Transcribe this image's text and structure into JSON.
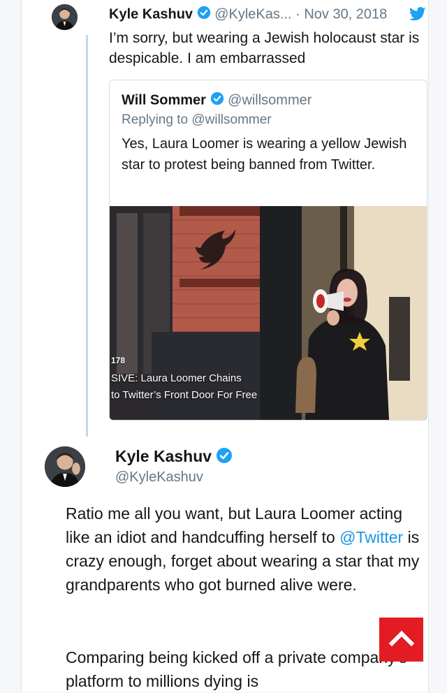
{
  "reply_tweet": {
    "name": "Kyle Kashuv",
    "handle": "@KyleKas...",
    "separator": "·",
    "date": "Nov 30, 2018",
    "text": "I’m sorry, but wearing a Jewish holocaust star is despicable. I am embarrassed"
  },
  "quoted_tweet": {
    "name": "Will Sommer",
    "handle": "@willsommer",
    "replying_to": "Replying to @willsommer",
    "text": "Yes, Laura Loomer is wearing a yellow Jewish star to protest being banned from Twitter.",
    "media": {
      "caption_number": "178",
      "caption_line1": "SIVE: Laura Loomer Chains",
      "caption_line2": "to Twitter’s Front Door For Free"
    }
  },
  "main_tweet": {
    "name": "Kyle Kashuv",
    "handle": "@KyleKashuv",
    "para1_before": "Ratio me all you want, but Laura Loomer acting like an idiot and handcuffing herself to ",
    "para1_mention": "@Twitter",
    "para1_after": " is crazy enough, forget about wearing a star that my grandparents who got burned alive were.",
    "para2": "Comparing being kicked off a private company’s platform to millions dying is"
  },
  "colors": {
    "accent": "#1da1f2",
    "verified": "#1da1f2",
    "scroll_button": "#e31b23",
    "thread_line": "#b9dbf3"
  },
  "icons": [
    "verified-badge-icon",
    "twitter-bird-icon",
    "chevron-up-icon"
  ]
}
